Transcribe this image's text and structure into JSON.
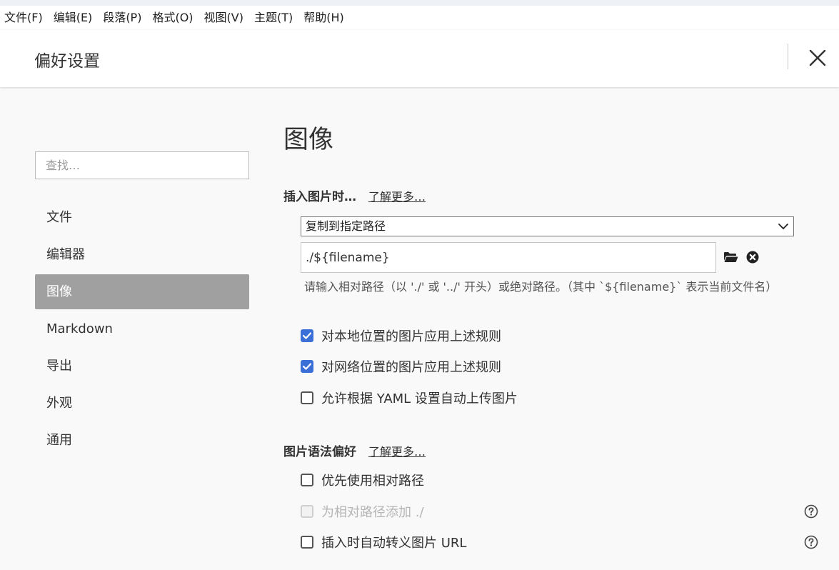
{
  "menubar": {
    "items": [
      "文件(F)",
      "编辑(E)",
      "段落(P)",
      "格式(O)",
      "视图(V)",
      "主题(T)",
      "帮助(H)"
    ]
  },
  "header": {
    "title": "偏好设置",
    "close_icon": "close-icon"
  },
  "sidebar": {
    "search_placeholder": "查找…",
    "items": [
      {
        "label": "文件",
        "active": false
      },
      {
        "label": "编辑器",
        "active": false
      },
      {
        "label": "图像",
        "active": true
      },
      {
        "label": "Markdown",
        "active": false
      },
      {
        "label": "导出",
        "active": false
      },
      {
        "label": "外观",
        "active": false
      },
      {
        "label": "通用",
        "active": false
      }
    ]
  },
  "main": {
    "title": "图像",
    "insert_group": {
      "label": "插入图片时…",
      "learn_more": "了解更多…",
      "select_value": "复制到指定路径",
      "path_value": "./${filename}",
      "hint": "请输入相对路径（以 './' 或 '../' 开头）或绝对路径。（其中 `${filename}` 表示当前文件名）",
      "options": [
        {
          "label": "对本地位置的图片应用上述规则",
          "checked": true,
          "disabled": false
        },
        {
          "label": "对网络位置的图片应用上述规则",
          "checked": true,
          "disabled": false
        },
        {
          "label": "允许根据 YAML 设置自动上传图片",
          "checked": false,
          "disabled": false
        }
      ]
    },
    "syntax_group": {
      "label": "图片语法偏好",
      "learn_more": "了解更多…",
      "options": [
        {
          "label": "优先使用相对路径",
          "checked": false,
          "disabled": false
        },
        {
          "label": "为相对路径添加 ./",
          "checked": false,
          "disabled": true
        },
        {
          "label": "插入时自动转义图片 URL",
          "checked": false,
          "disabled": false
        }
      ]
    }
  },
  "colors": {
    "accent": "#3b6fd8",
    "nav_active_bg": "#a0a0a0",
    "page_bg": "#f9f9f9"
  }
}
